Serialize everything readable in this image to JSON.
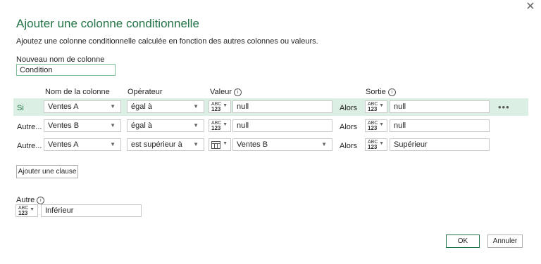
{
  "dialog": {
    "title": "Ajouter une colonne conditionnelle",
    "subtitle": "Ajoutez une colonne conditionnelle calculée en fonction des autres colonnes ou valeurs.",
    "close_glyph": "✕"
  },
  "new_column": {
    "label": "Nouveau nom de colonne",
    "value": "Condition"
  },
  "headers": {
    "column": "Nom de la colonne",
    "operator": "Opérateur",
    "value": "Valeur",
    "output": "Sortie"
  },
  "type_icon": {
    "line1": "ABC",
    "line2": "123"
  },
  "rows": [
    {
      "prefix": "Si",
      "column": "Ventes A",
      "operator": "égal à",
      "value": "null",
      "then": "Alors",
      "output": "null"
    },
    {
      "prefix": "Autre...",
      "column": "Ventes B",
      "operator": "égal à",
      "value": "null",
      "then": "Alors",
      "output": "null"
    },
    {
      "prefix": "Autre...",
      "column": "Ventes A",
      "operator": "est supérieur à",
      "value": "Ventes B",
      "then": "Alors",
      "output": "Supérieur"
    }
  ],
  "more_glyph": "•••",
  "add_clause": "Ajouter une clause",
  "else": {
    "label": "Autre",
    "value": "Inférieur"
  },
  "buttons": {
    "ok": "OK",
    "cancel": "Annuler"
  },
  "colors": {
    "accent": "#217346",
    "selected_row": "#dcefe4"
  }
}
